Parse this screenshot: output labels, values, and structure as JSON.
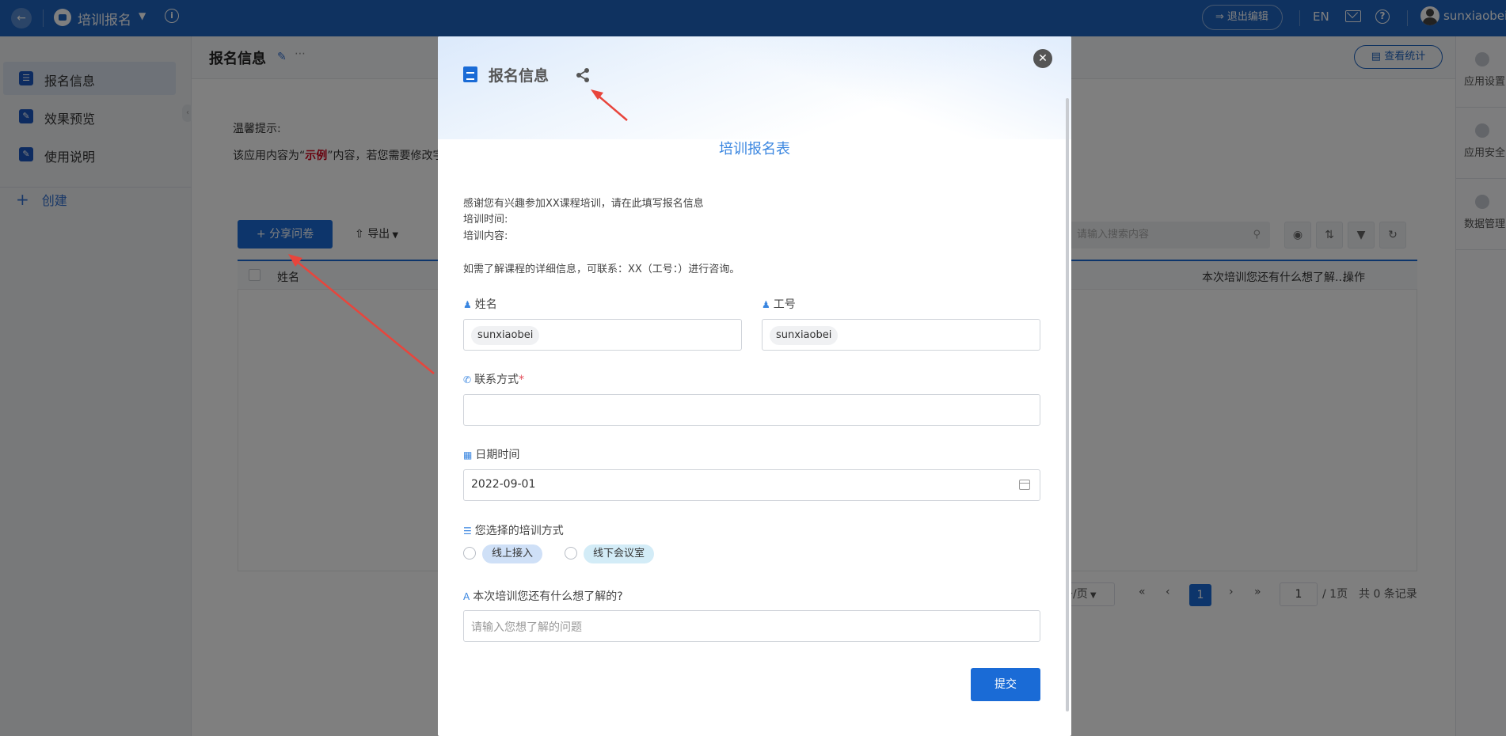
{
  "topbar": {
    "app_name": "培训报名",
    "exit_edit": "退出编辑",
    "lang": "EN",
    "username": "sunxiaobei"
  },
  "sidebar": {
    "items": [
      {
        "label": "报名信息",
        "icon": "form-icon"
      },
      {
        "label": "效果预览",
        "icon": "edit-icon"
      },
      {
        "label": "使用说明",
        "icon": "edit-icon"
      }
    ],
    "create": "创建"
  },
  "rightbar": {
    "items": [
      {
        "label": "应用设置",
        "icon": "gear-icon"
      },
      {
        "label": "应用安全",
        "icon": "shield-icon"
      },
      {
        "label": "数据管理",
        "icon": "database-icon"
      }
    ]
  },
  "main": {
    "title": "报名信息",
    "stats_button": "查看统计",
    "hint_title": "温馨提示:",
    "hint_prefix": "该应用内容为“",
    "hint_bold": "示例",
    "hint_suffix": "”内容，若您需要修改字",
    "share_button": "分享问卷",
    "export_button": "导出",
    "search_placeholder": "请输入搜索内容",
    "table": {
      "col_name": "姓名",
      "col_question": "本次培训您还有什么想了解...",
      "col_action": "操作"
    },
    "pager": {
      "page_size": "条/页",
      "current_page": "1",
      "input_page": "1",
      "total_pages": "/ 1页",
      "total_records": "共 0 条记录"
    }
  },
  "modal": {
    "header_title": "报名信息",
    "form_title": "培训报名表",
    "intro_lines": [
      "感谢您有兴趣参加XX课程培训，请在此填写报名信息",
      "培训时间:",
      "培训内容:",
      "如需了解课程的详细信息，可联系：XX（工号：）进行咨询。"
    ],
    "fields": {
      "name_label": "姓名",
      "name_value": "sunxiaobei",
      "id_label": "工号",
      "id_value": "sunxiaobei",
      "contact_label": "联系方式",
      "contact_required": "*",
      "date_label": "日期时间",
      "date_value": "2022-09-01",
      "method_label": "您选择的培训方式",
      "method_options": [
        "线上接入",
        "线下会议室"
      ],
      "question_label": "本次培训您还有什么想了解的?",
      "question_placeholder": "请输入您想了解的问题"
    },
    "submit": "提交"
  },
  "colors": {
    "brand": "#1f64c1",
    "primary": "#1a6bd6",
    "form_title": "#3a86e0",
    "annotation_arrow": "#e8453c"
  }
}
